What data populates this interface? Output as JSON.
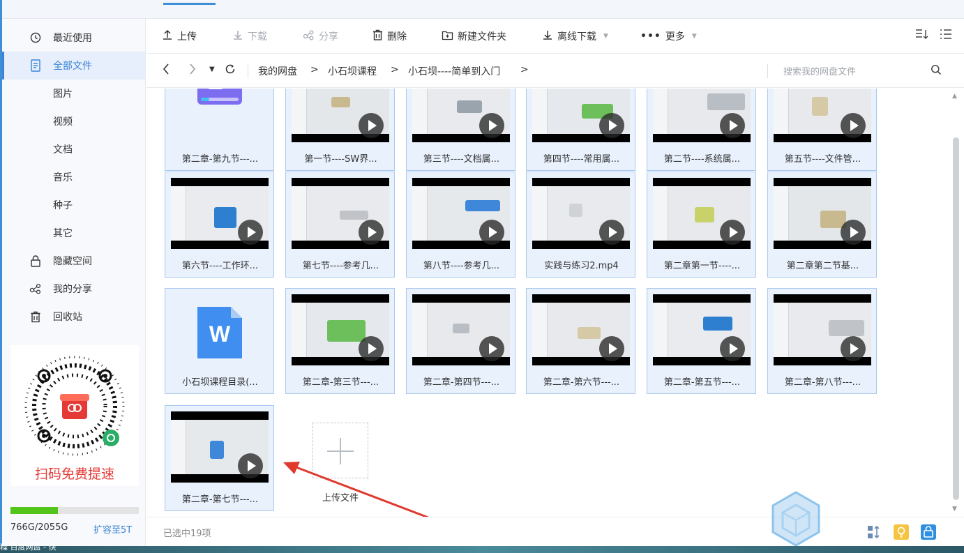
{
  "sidebar": {
    "items": [
      {
        "label": "最近使用",
        "icon": "clock-icon"
      },
      {
        "label": "全部文件",
        "icon": "document-icon",
        "active": true
      },
      {
        "label": "图片"
      },
      {
        "label": "视频"
      },
      {
        "label": "文档"
      },
      {
        "label": "音乐"
      },
      {
        "label": "种子"
      },
      {
        "label": "其它"
      },
      {
        "label": "隐藏空间",
        "icon": "lock-icon"
      },
      {
        "label": "我的分享",
        "icon": "share-icon"
      },
      {
        "label": "回收站",
        "icon": "trash-icon"
      }
    ],
    "promo_text": "扫码免费提速",
    "quota_text": "766G/2055G",
    "quota_fraction": 0.37,
    "expand_label": "扩容至5T"
  },
  "toolbar": {
    "upload": "上传",
    "download": "下载",
    "share": "分享",
    "delete": "删除",
    "new_folder": "新建文件夹",
    "offline_download": "离线下载",
    "more": "更多"
  },
  "address": {
    "crumbs": [
      "我的网盘",
      "小石坝课程",
      "小石坝----简单到入门"
    ],
    "separator": ">",
    "search_placeholder": "搜索我的网盘文件"
  },
  "files": [
    {
      "name": "第二章-第九节---...",
      "kind": "video-icon-file"
    },
    {
      "name": "第一节----SW界...",
      "kind": "video"
    },
    {
      "name": "第三节----文档属...",
      "kind": "video"
    },
    {
      "name": "第四节----常用属...",
      "kind": "video"
    },
    {
      "name": "第二节----系统属...",
      "kind": "video"
    },
    {
      "name": "第五节----文件管...",
      "kind": "video"
    },
    {
      "name": "第六节----工作环...",
      "kind": "video"
    },
    {
      "name": "第七节----参考几...",
      "kind": "video"
    },
    {
      "name": "第八节----参考几...",
      "kind": "video"
    },
    {
      "name": "实践与练习2.mp4",
      "kind": "video"
    },
    {
      "name": "第二章第一节----...",
      "kind": "video"
    },
    {
      "name": "第二章第二节基...",
      "kind": "video"
    },
    {
      "name": "小石坝课程目录(...",
      "kind": "word"
    },
    {
      "name": "第二章-第三节---...",
      "kind": "video"
    },
    {
      "name": "第二章-第四节---...",
      "kind": "video"
    },
    {
      "name": "第二章-第六节---...",
      "kind": "video"
    },
    {
      "name": "第二章-第五节---...",
      "kind": "video"
    },
    {
      "name": "第二章-第八节---...",
      "kind": "video"
    },
    {
      "name": "第二章-第七节---...",
      "kind": "video"
    }
  ],
  "upload_tile": "上传文件",
  "status": {
    "selected": "已选中19项"
  },
  "taskbar_text": "程 百度网盘 - 快",
  "colors": {
    "accent": "#3b84d6",
    "selected_bg": "#e9f1fd",
    "promo_red": "#e53935",
    "quota_green": "#52c41a"
  }
}
